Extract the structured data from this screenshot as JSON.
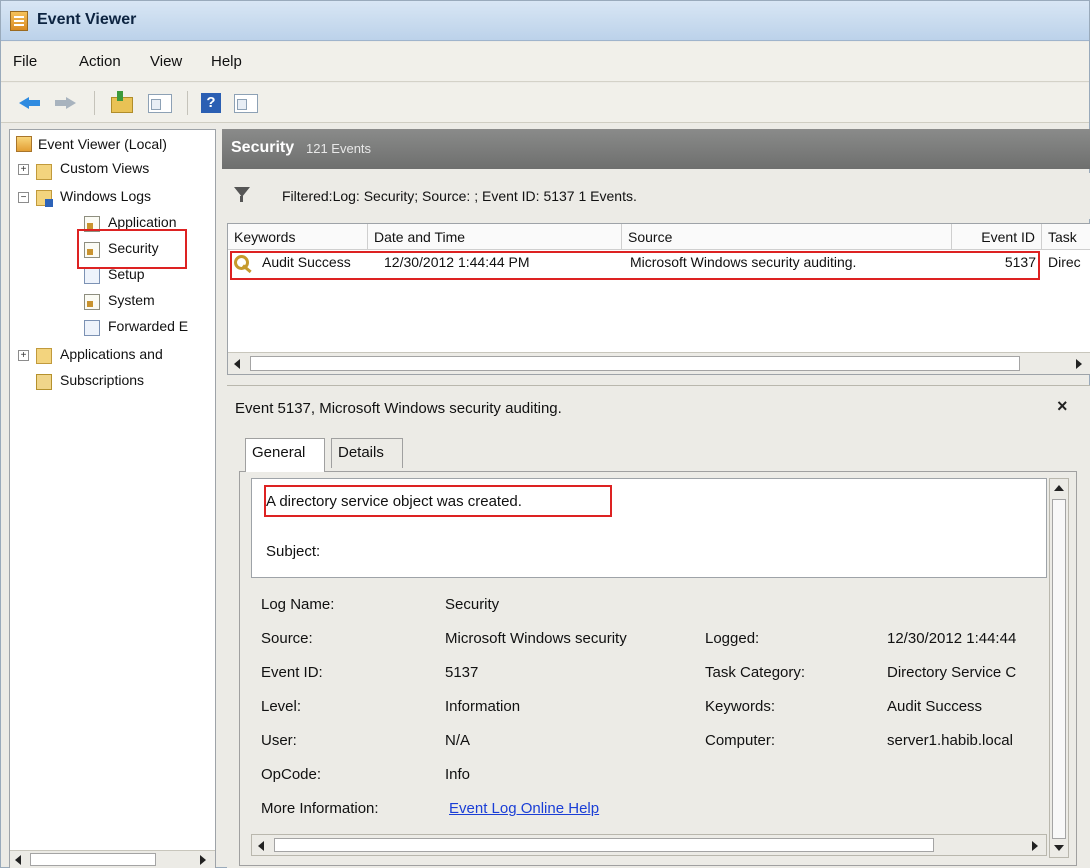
{
  "window": {
    "title": "Event Viewer"
  },
  "menu": [
    "File",
    "Action",
    "View",
    "Help"
  ],
  "toolbar": {
    "icons": [
      "back-arrow-icon",
      "forward-arrow-icon",
      "folder-up-icon",
      "show-pane-icon",
      "help-icon",
      "action-pane-icon"
    ]
  },
  "tree": {
    "root": "Event Viewer (Local)",
    "custom_views": "Custom Views",
    "windows_logs": "Windows Logs",
    "logs": [
      "Application",
      "Security",
      "Setup",
      "System",
      "Forwarded E"
    ],
    "apps_services": "Applications and",
    "subscriptions": "Subscriptions",
    "expand_plus": "+",
    "collapse_minus": "−"
  },
  "header": {
    "title": "Security",
    "count": "121 Events"
  },
  "filter": {
    "text": "Filtered:Log: Security; Source: ; Event ID: 5137 1 Events."
  },
  "events": {
    "columns": [
      "Keywords",
      "Date and Time",
      "Source",
      "Event ID",
      "Task"
    ],
    "rows": [
      {
        "keywords": "Audit Success",
        "date": "12/30/2012 1:44:44 PM",
        "source": "Microsoft Windows security auditing.",
        "event_id": "5137",
        "task": "Direc"
      }
    ]
  },
  "detail": {
    "title": "Event 5137, Microsoft Windows security auditing.",
    "close": "×",
    "tabs": [
      "General",
      "Details"
    ],
    "message": "A directory service object was created.",
    "subject": "Subject:",
    "fields": {
      "log_name_label": "Log Name:",
      "log_name": "Security",
      "source_label": "Source:",
      "source": "Microsoft Windows security",
      "logged_label": "Logged:",
      "logged": "12/30/2012 1:44:44",
      "event_id_label": "Event ID:",
      "event_id": "5137",
      "task_category_label": "Task Category:",
      "task_category": "Directory Service C",
      "level_label": "Level:",
      "level": "Information",
      "keywords_label": "Keywords:",
      "keywords": "Audit Success",
      "user_label": "User:",
      "user": "N/A",
      "computer_label": "Computer:",
      "computer": "server1.habib.local",
      "opcode_label": "OpCode:",
      "opcode": "Info",
      "more_info_label": "More Information:",
      "more_info_link": "Event Log Online Help"
    }
  },
  "colors": {
    "highlight_box": "#dd2222",
    "link": "#1a3ed6",
    "header_bg": "#7c7d7c"
  }
}
